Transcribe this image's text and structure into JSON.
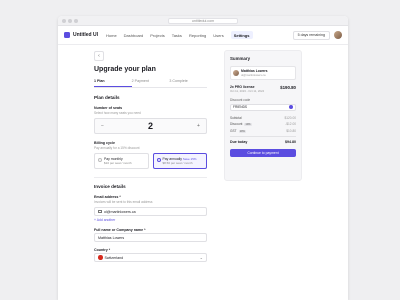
{
  "browser": {
    "url": "untitledui.com"
  },
  "nav": {
    "logo": "Untitled UI",
    "links": [
      "Home",
      "Dashboard",
      "Projects",
      "Tasks",
      "Reporting",
      "Users",
      "Settings"
    ],
    "active_index": 6,
    "trial": "5 days remaining"
  },
  "page": {
    "title": "Upgrade your plan",
    "steps": [
      "Plan",
      "Payment",
      "Complete"
    ],
    "active_step": 0,
    "plan_details": "Plan details",
    "seats": {
      "label": "Number of seats",
      "hint": "Select how many seats you need",
      "value": "2"
    },
    "billing": {
      "label": "Billing cycle",
      "hint": "Pay annually for a 15% discount",
      "monthly": {
        "title": "Pay monthly",
        "price": "$10 per seat / month"
      },
      "annually": {
        "title": "Pay annually",
        "save": "Save 15%",
        "price": "$8.50 per seat / month"
      }
    },
    "invoice": {
      "title": "Invoice details",
      "email_label": "Email address *",
      "email_hint": "Invoices will be sent to this email address",
      "email": "ol@martinlowers.ca",
      "add_another": "+ Add another",
      "name_label": "Full name or Company name *",
      "name": "Matthias Lowers",
      "country_label": "Country *",
      "country": "Switzerland"
    }
  },
  "summary": {
    "title": "Summary",
    "user": {
      "name": "Matthias Lowers",
      "email": "ol@martinlowers.ca"
    },
    "plan": {
      "title": "2x PRO license",
      "dates": "Oct 11, 2023 - Oct 11, 2024",
      "price": "$190.80"
    },
    "discount_label": "Discount code",
    "discount_code": "FRIENDS",
    "subtotal": {
      "label": "Subtotal",
      "value": "$120.00"
    },
    "discount": {
      "label": "Discount",
      "pct": "10%",
      "value": "-$12.00"
    },
    "gst": {
      "label": "GST",
      "pct": "10%",
      "value": "$10.80"
    },
    "due": {
      "label": "Due today",
      "value": "$94.80"
    },
    "cta": "Continue to payment"
  },
  "colors": {
    "accent": "#5b4de0",
    "background": "#efeff1"
  }
}
